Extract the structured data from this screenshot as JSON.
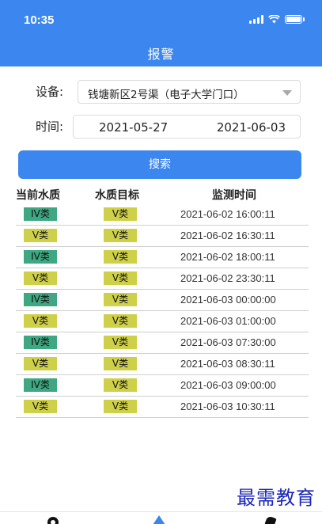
{
  "status_bar": {
    "time": "10:35"
  },
  "header": {
    "title": "报警"
  },
  "form": {
    "device_label": "设备:",
    "device_value": "钱塘新区2号渠（电子大学门口）",
    "time_label": "时间:",
    "date_start": "2021-05-27",
    "date_end": "2021-06-03",
    "search_label": "搜索"
  },
  "table": {
    "headers": [
      "当前水质",
      "水质目标",
      "监测时间"
    ],
    "rows": [
      {
        "current": "IV类",
        "target": "V类",
        "time": "2021-06-02 16:00:11"
      },
      {
        "current": "V类",
        "target": "V类",
        "time": "2021-06-02 16:30:11"
      },
      {
        "current": "IV类",
        "target": "V类",
        "time": "2021-06-02 18:00:11"
      },
      {
        "current": "V类",
        "target": "V类",
        "time": "2021-06-02 23:30:11"
      },
      {
        "current": "IV类",
        "target": "V类",
        "time": "2021-06-03 00:00:00"
      },
      {
        "current": "V类",
        "target": "V类",
        "time": "2021-06-03 01:00:00"
      },
      {
        "current": "IV类",
        "target": "V类",
        "time": "2021-06-03 07:30:00"
      },
      {
        "current": "V类",
        "target": "V类",
        "time": "2021-06-03 08:30:11"
      },
      {
        "current": "IV类",
        "target": "V类",
        "time": "2021-06-03 09:00:00"
      },
      {
        "current": "V类",
        "target": "V类",
        "time": "2021-06-03 10:30:11"
      }
    ]
  },
  "colors": {
    "accent": "#3c87ef",
    "badge_iv": "#3fa882",
    "badge_v": "#cfd04a"
  },
  "watermark": "最需教育",
  "tabbar": {
    "icons": [
      "user-icon",
      "alarm-icon",
      "phone-icon"
    ]
  }
}
